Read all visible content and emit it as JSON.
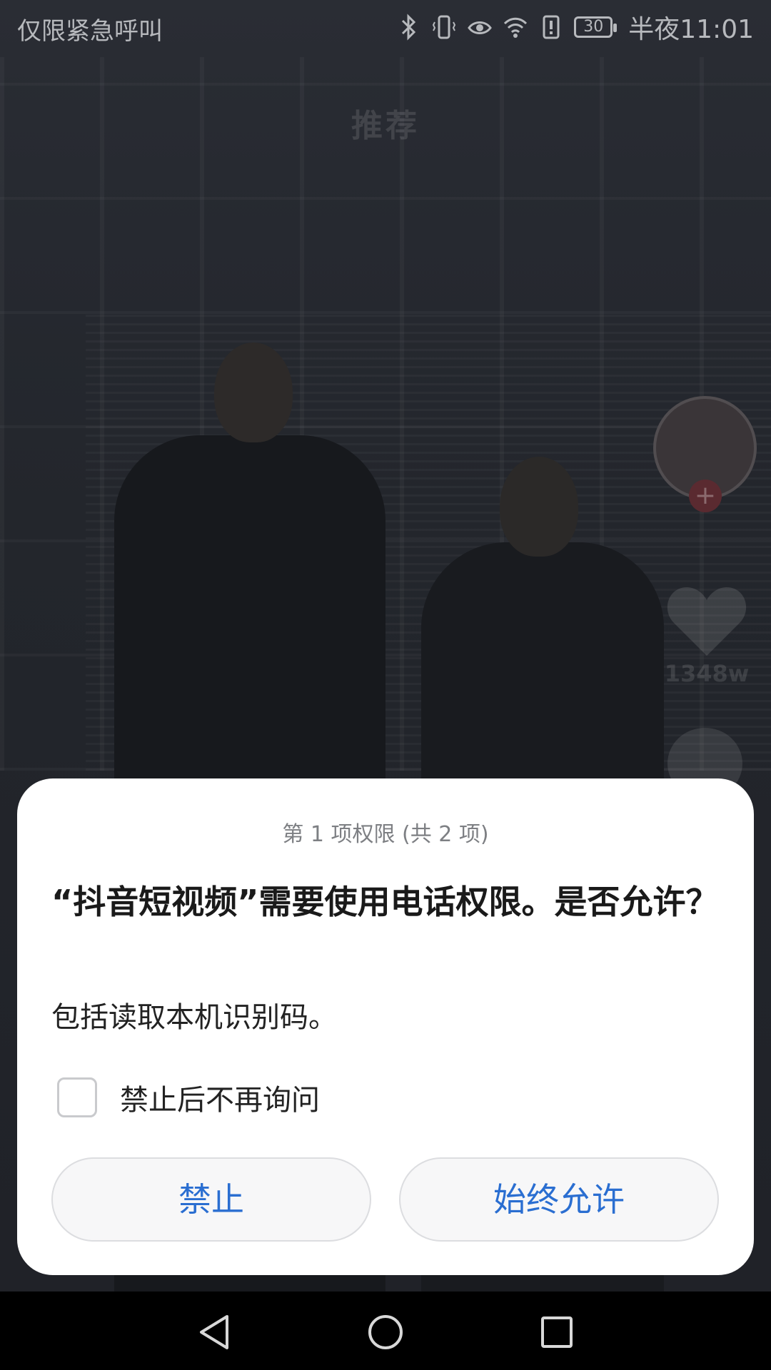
{
  "status_bar": {
    "carrier_text": "仅限紧急呼叫",
    "battery_level": "30",
    "time": "半夜11:01",
    "icons": [
      "bluetooth-icon",
      "vibrate-icon",
      "eye-comfort-icon",
      "wifi-icon",
      "alert-icon",
      "battery-icon"
    ]
  },
  "background_app": {
    "feed_tab": "推荐",
    "likes_count": "1348w",
    "follow_symbol": "+"
  },
  "dialog": {
    "counter": "第 1 项权限 (共 2 项)",
    "title": "“抖音短视频”需要使用电话权限。是否允许？",
    "description": "包括读取本机识别码。",
    "checkbox_label": "禁止后不再询问",
    "checkbox_checked": false,
    "deny_label": "禁止",
    "allow_label": "始终允许"
  },
  "nav_bar": {
    "icons": [
      "back-icon",
      "home-icon",
      "recents-icon"
    ]
  },
  "colors": {
    "accent": "#2a6ed1",
    "dialog_bg": "#ffffff",
    "scrim": "#1b1d22"
  }
}
